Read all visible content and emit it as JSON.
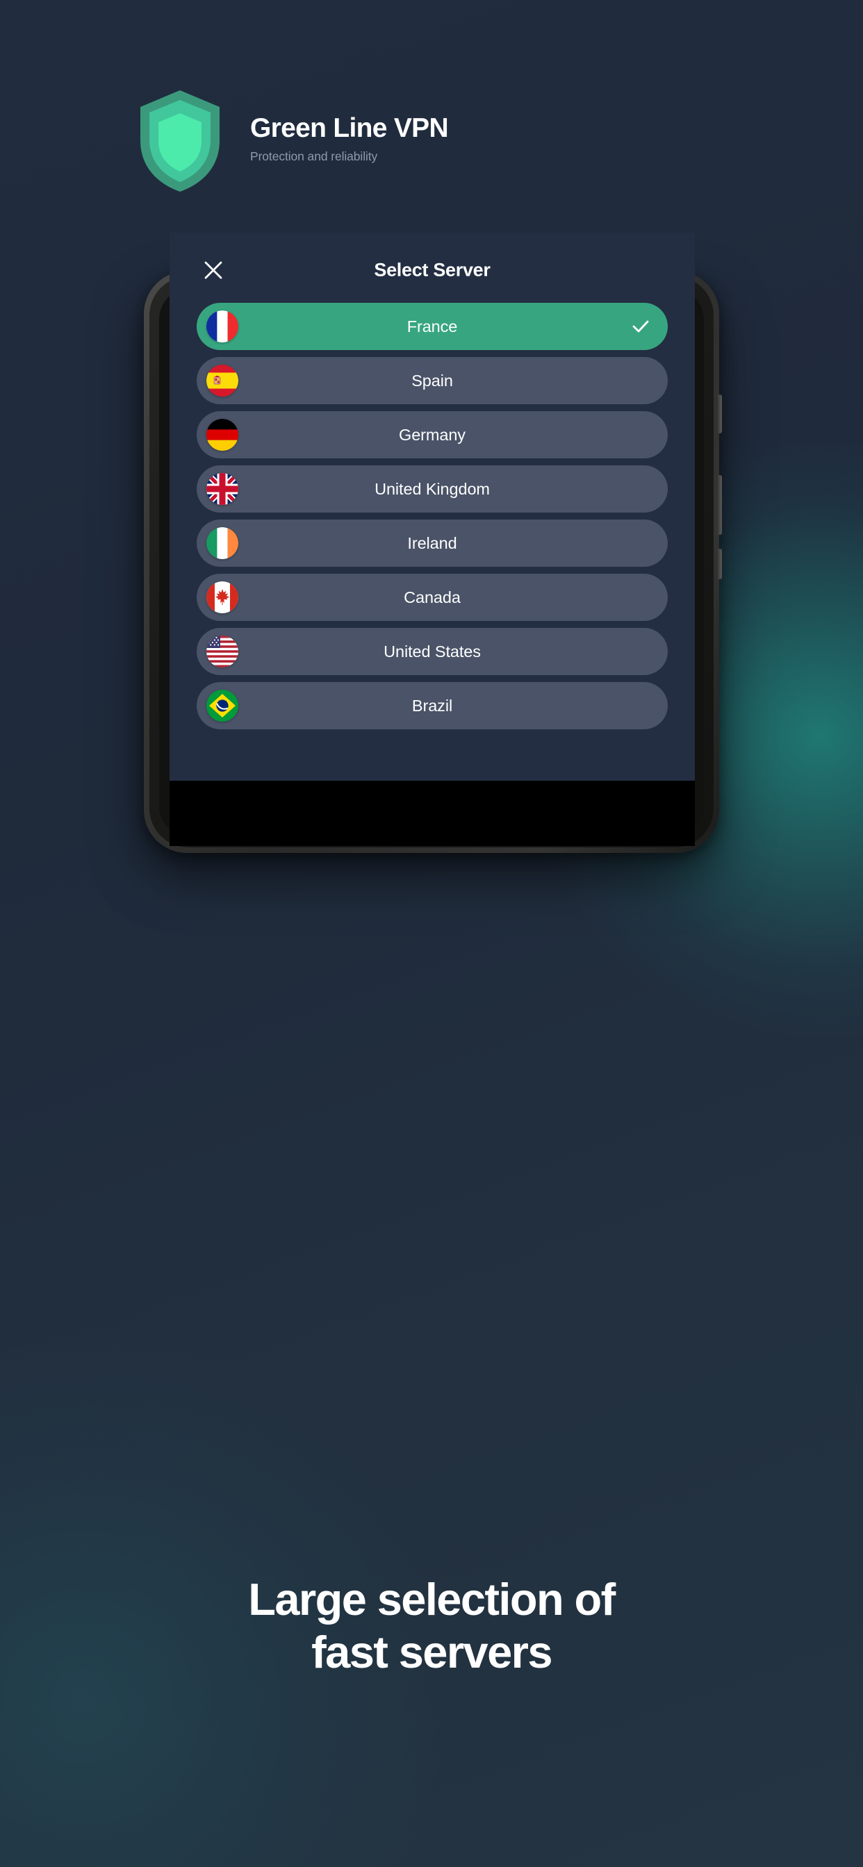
{
  "brand": {
    "title": "Green Line VPN",
    "subtitle": "Protection and reliability",
    "logo_icon": "shield-icon",
    "colors": {
      "shield_outer": "#3c9a7c",
      "shield_mid": "#41c79b",
      "shield_inner": "#4ceaab",
      "accent": "#37a680",
      "background": "#212c3f",
      "glow": "#1eaa96"
    }
  },
  "phone": {
    "camera_icon": "front-camera-icon",
    "speaker_icon": "earpiece-speaker-icon",
    "sensor_icon": "proximity-sensor-icon"
  },
  "app": {
    "title": "Select Server",
    "close_icon": "close-icon",
    "screen_background": "#232e42",
    "row_background": "#4a5367",
    "selected_row_background": "#37a680",
    "check_icon": "check-icon",
    "servers": [
      {
        "name": "France",
        "flag": "flag-fr",
        "selected": true
      },
      {
        "name": "Spain",
        "flag": "flag-es",
        "selected": false
      },
      {
        "name": "Germany",
        "flag": "flag-de",
        "selected": false
      },
      {
        "name": "United Kingdom",
        "flag": "flag-gb",
        "selected": false
      },
      {
        "name": "Ireland",
        "flag": "flag-ie",
        "selected": false
      },
      {
        "name": "Canada",
        "flag": "flag-ca",
        "selected": false
      },
      {
        "name": "United States",
        "flag": "flag-us",
        "selected": false
      },
      {
        "name": "Brazil",
        "flag": "flag-br",
        "selected": false
      }
    ]
  },
  "tagline": {
    "line1": "Large selection of",
    "line2": "fast servers"
  }
}
